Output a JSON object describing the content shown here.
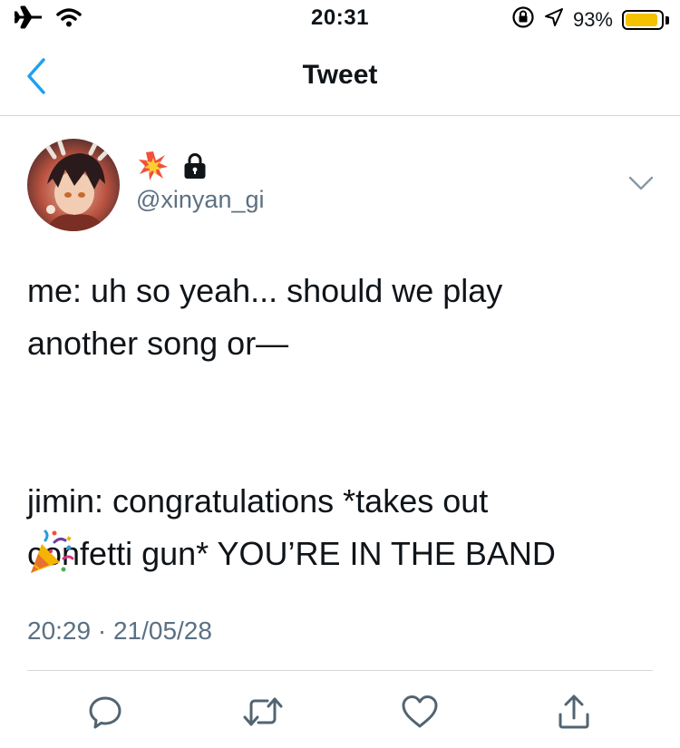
{
  "status_bar": {
    "time": "20:31",
    "battery_percent_label": "93%",
    "battery_level": 0.93,
    "battery_color": "#f5c200",
    "left_icons": [
      "airplane-icon",
      "wifi-icon"
    ],
    "right_icons": [
      "orientation-lock-icon",
      "location-arrow-icon"
    ]
  },
  "nav": {
    "title": "Tweet",
    "back_icon": "chevron-left-icon",
    "accent_color": "#1da1f2"
  },
  "tweet": {
    "display_name_icons": [
      "collision-emoji",
      "lock-icon"
    ],
    "handle": "@xinyan_gi",
    "text": "me: uh so yeah... should we play\nanother song or—\n\n\njimin: congratulations *takes out\nconfetti gun* YOU’RE IN THE BAND",
    "trailing_emoji": "party-popper-emoji",
    "timestamp": "20:29 · 21/05/28"
  },
  "actions": [
    "reply-icon",
    "retweet-icon",
    "like-icon",
    "share-icon"
  ],
  "colors": {
    "secondary_text": "#5b7083",
    "divider": "#d6d6d6",
    "icon_gray": "#536471"
  }
}
